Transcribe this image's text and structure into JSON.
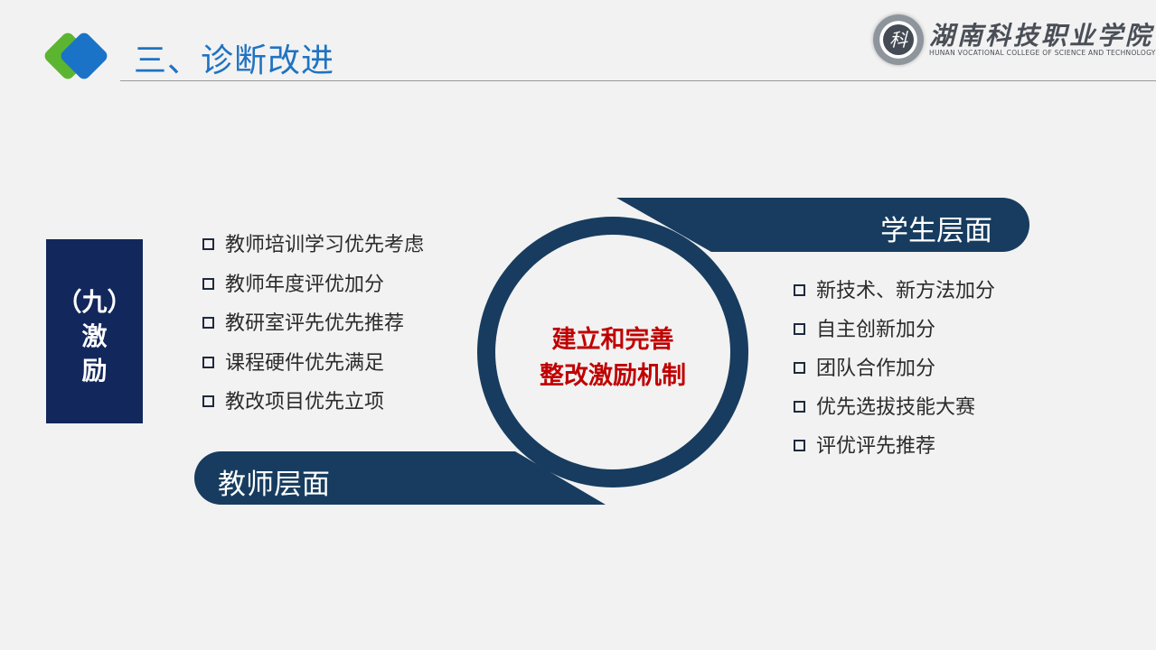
{
  "header": {
    "title": "三、诊断改进",
    "logo": {
      "seal_char": "科",
      "name": "湖南科技职业学院",
      "subtitle": "HUNAN VOCATIONAL COLLEGE OF SCIENCE AND TECHNOLOGY"
    }
  },
  "tag": {
    "line1": "（九）",
    "line2": "激",
    "line3": "励"
  },
  "teacher": {
    "banner": "教师层面",
    "items": [
      "教师培训学习优先考虑",
      "教师年度评优加分",
      "教研室评先优先推荐",
      "课程硬件优先满足",
      "教改项目优先立项"
    ]
  },
  "student": {
    "banner": "学生层面",
    "items": [
      "新技术、新方法加分",
      "自主创新加分",
      "团队合作加分",
      "优先选拔技能大赛",
      "评优评先推荐"
    ]
  },
  "center": {
    "line1": "建立和完善",
    "line2": "整改激励机制"
  },
  "colors": {
    "title_blue": "#1f73c2",
    "navy": "#12275c",
    "banner": "#173c5f",
    "accent_red": "#c00000",
    "green": "#5cb531"
  },
  "icons": {
    "checkbox": "square-checkbox-icon",
    "header_mark": "double-diamond-icon"
  }
}
